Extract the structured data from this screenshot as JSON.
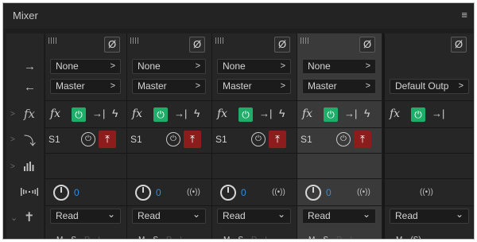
{
  "panel": {
    "title": "Mixer",
    "menu_icon": "≡"
  },
  "row_labels": {
    "input_icon": "→",
    "output_icon": "←",
    "fx_label": "fx",
    "sends_icon": "⤵",
    "eq_icon": "eq-bars-icon",
    "pan_icon": "|||·|||",
    "auto_icon": "✝"
  },
  "tracks": [
    {
      "phase": "Ø",
      "input": "None",
      "output": "Master",
      "fx": "fx",
      "send": "S1",
      "pan_value": "0",
      "automation": "Read",
      "msri": [
        "M",
        "S",
        "R",
        "I"
      ]
    },
    {
      "phase": "Ø",
      "input": "None",
      "output": "Master",
      "fx": "fx",
      "send": "S1",
      "pan_value": "0",
      "automation": "Read",
      "msri": [
        "M",
        "S",
        "R",
        "I"
      ]
    },
    {
      "phase": "Ø",
      "input": "None",
      "output": "Master",
      "fx": "fx",
      "send": "S1",
      "pan_value": "0",
      "automation": "Read",
      "msri": [
        "M",
        "S",
        "R",
        "I"
      ]
    },
    {
      "phase": "Ø",
      "input": "None",
      "output": "Master",
      "fx": "fx",
      "send": "S1",
      "pan_value": "0",
      "automation": "Read",
      "msri": [
        "M",
        "S",
        "R",
        "I"
      ]
    }
  ],
  "master": {
    "phase": "Ø",
    "output": "Default Outp",
    "fx": "fx",
    "automation": "Read",
    "msri": [
      "M",
      "(S)"
    ]
  },
  "glyphs": {
    "arrow_right": ">",
    "chevron_down": "⌄",
    "power": "⏻",
    "post": "→|",
    "bolt": "ϟ",
    "send_red": "⤒",
    "stereo": "((•))"
  },
  "colors": {
    "power_green": "#1fae6a",
    "send_red": "#8d1d1d",
    "value_blue": "#2f8ee0"
  }
}
